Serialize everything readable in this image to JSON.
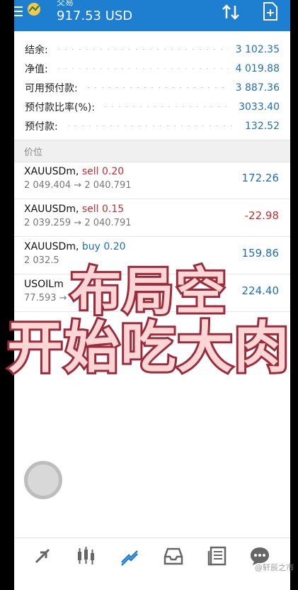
{
  "header": {
    "title": "交易",
    "balance": "917.53 USD"
  },
  "account": [
    {
      "label": "结余:",
      "value": "3 102.35"
    },
    {
      "label": "净值:",
      "value": "4 019.88"
    },
    {
      "label": "可用预付款:",
      "value": "3 887.36"
    },
    {
      "label": "预付款比率(%):",
      "value": "3033.40"
    },
    {
      "label": "预付款:",
      "value": "132.52"
    }
  ],
  "section_title": "价位",
  "positions": [
    {
      "symbol": "XAUUSDm,",
      "side": "sell 0.20",
      "prices": "2 049.404 → 2 040.791",
      "profit": "172.26",
      "profit_sign": "positive"
    },
    {
      "symbol": "XAUUSDm,",
      "side": "sell 0.15",
      "prices": "2 039.259 → 2 040.791",
      "profit": "-22.98",
      "profit_sign": "negative"
    },
    {
      "symbol": "XAUUSDm,",
      "side": "buy 0.20",
      "prices": "2 032.5",
      "profit": "159.86",
      "profit_sign": "positive"
    },
    {
      "symbol": "USOILm",
      "side": "",
      "prices": "77.593 →",
      "profit": "224.40",
      "profit_sign": "positive"
    }
  ],
  "overlay": {
    "line1": "布局空",
    "line2": "开始吃大肉"
  },
  "nav": [
    "quotes-icon",
    "chart-icon",
    "trade-icon",
    "history-icon",
    "news-icon",
    "messages-icon"
  ],
  "watermark": "@轩辰之市",
  "colors": {
    "header_bg": "#1e7fd1",
    "value_blue": "#1f6fb8",
    "sell_red": "#c03030",
    "caption_fill": "#ffd6d6",
    "caption_stroke": "#9b2c3c"
  }
}
